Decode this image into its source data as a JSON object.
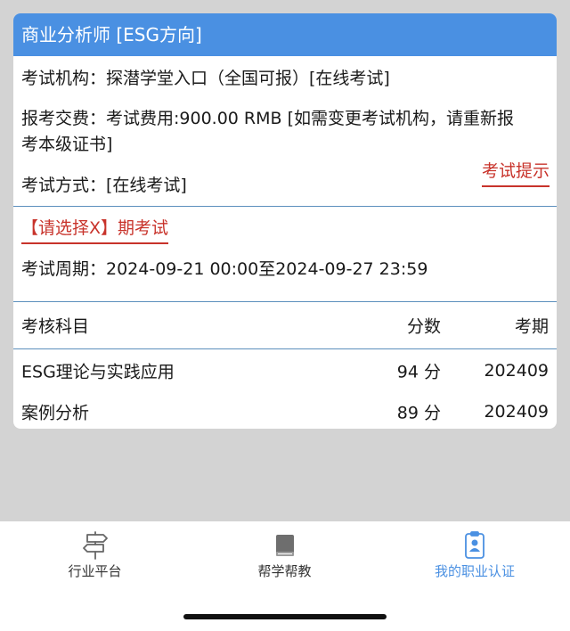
{
  "header": {
    "title": "商业分析师 [ESG方向]"
  },
  "info": {
    "institution": "考试机构：探潜学堂入口（全国可报）[在线考试]",
    "fee_line1": "报考交费：考试费用:900.00 RMB [如需变更考试机构，请重新报",
    "fee_line2": "考本级证书]",
    "method": "考试方式：[在线考试]",
    "tip_link": "考试提示"
  },
  "session": {
    "select_label": "【请选择X】期考试",
    "period": "考试周期：2024-09-21 00:00至2024-09-27 23:59"
  },
  "table": {
    "headers": {
      "subject": "考核科目",
      "score": "分数",
      "period": "考期"
    },
    "rows": [
      {
        "subject": "ESG理论与实践应用",
        "score": "94 分",
        "period": "202409"
      },
      {
        "subject": "案例分析",
        "score": "89 分",
        "period": "202409"
      }
    ]
  },
  "tabbar": {
    "items": [
      {
        "label": "行业平台",
        "icon": "signpost-icon"
      },
      {
        "label": "帮学帮教",
        "icon": "book-icon"
      },
      {
        "label": "我的职业认证",
        "icon": "id-badge-icon"
      }
    ],
    "active_index": 2,
    "colors": {
      "active": "#4a90e2",
      "inactive": "#666666"
    }
  },
  "colors": {
    "header_bg": "#4a90e2",
    "link_red": "#c8332b",
    "page_bg": "#d3d3d3"
  }
}
